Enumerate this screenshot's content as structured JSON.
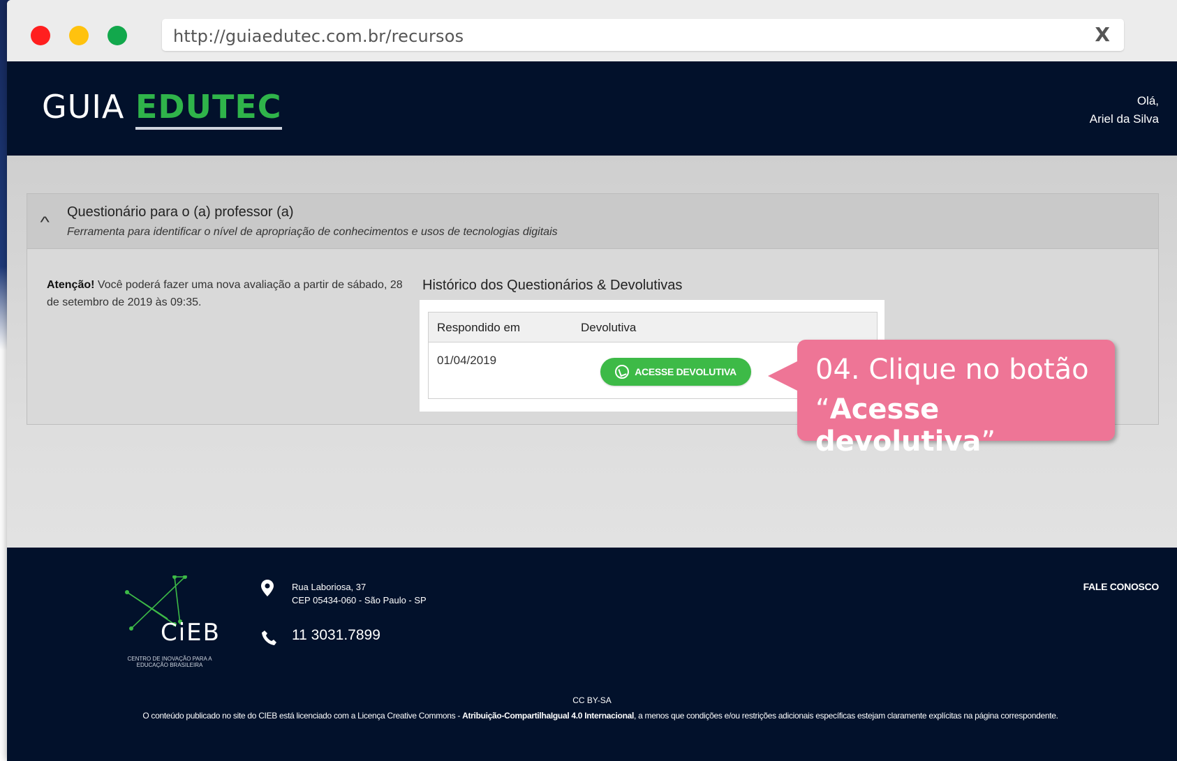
{
  "browser": {
    "url": "http://guiaedutec.com.br/recursos",
    "close_label": "X"
  },
  "header": {
    "logo_thin": "GUIA",
    "logo_bold": "EDUTEC",
    "greeting": "Olá,",
    "user_name": "Ariel da Silva"
  },
  "panel": {
    "title": "Questionário para o (a) professor (a)",
    "subtitle": "Ferramenta para identificar o nível de apropriação de conhecimentos e usos de tecnologias digitais",
    "attention_label": "Atenção!",
    "attention_text": " Você poderá fazer uma nova avaliação a partir de sábado, 28 de setembro de 2019 às 09:35.",
    "history_title": "Histórico dos Questionários & Devolutivas",
    "table": {
      "headers": [
        "Respondido em",
        "Devolutiva"
      ],
      "rows": [
        {
          "date": "01/04/2019",
          "button_label": "ACESSE DEVOLUTIVA"
        }
      ]
    }
  },
  "callout": {
    "line1": "04. Clique no botão",
    "line2_open": "“",
    "line2_bold": "Acesse devolutiva",
    "line2_close": "”"
  },
  "footer": {
    "logo_word": "CiEB",
    "logo_tagline": "CENTRO DE INOVAÇÃO PARA A EDUCAÇÃO BRASILEIRA",
    "address_line1": "Rua Laboriosa, 37",
    "address_line2": "CEP 05434-060 - São Paulo - SP",
    "phone": "11 3031.7899",
    "contact_link": "FALE CONOSCO",
    "cc_label": "CC BY-SA",
    "license_pre": "O conteúdo publicado no site do CIEB está licenciado com a Licença Creative Commons - ",
    "license_bold": "Atribuição-CompartilhaIgual 4.0 Internacional",
    "license_post": ", a menos que condições e/ou restrições adicionais específicas estejam claramente explícitas na página correspondente."
  },
  "colors": {
    "header_bg": "#02112b",
    "brand_green": "#2fb44a",
    "button_green": "#3dba47",
    "callout_pink": "#ee7596"
  }
}
